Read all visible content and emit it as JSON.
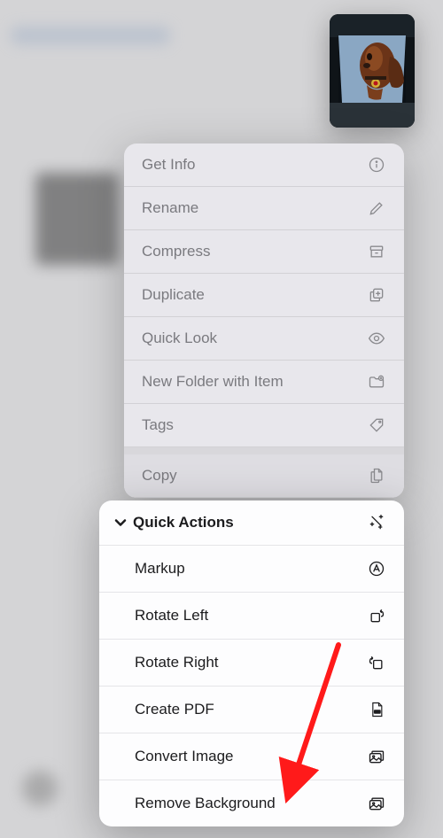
{
  "menu": {
    "items": [
      {
        "label": "Get Info",
        "icon": "info-icon"
      },
      {
        "label": "Rename",
        "icon": "pencil-icon"
      },
      {
        "label": "Compress",
        "icon": "archivebox-icon"
      },
      {
        "label": "Duplicate",
        "icon": "plus-square-on-square-icon"
      },
      {
        "label": "Quick Look",
        "icon": "eye-icon"
      },
      {
        "label": "New Folder with Item",
        "icon": "folder-plus-icon"
      },
      {
        "label": "Tags",
        "icon": "tag-icon"
      },
      {
        "label": "Copy",
        "icon": "doc-on-doc-icon"
      }
    ]
  },
  "quick_actions": {
    "title": "Quick Actions",
    "items": [
      {
        "label": "Markup",
        "icon": "markup-icon"
      },
      {
        "label": "Rotate Left",
        "icon": "rotate-left-icon"
      },
      {
        "label": "Rotate Right",
        "icon": "rotate-right-icon"
      },
      {
        "label": "Create PDF",
        "icon": "pdf-icon"
      },
      {
        "label": "Convert Image",
        "icon": "photo-stack-icon"
      },
      {
        "label": "Remove Background",
        "icon": "photo-stack-icon"
      }
    ]
  },
  "annotation": {
    "color": "#ff1a1a"
  }
}
